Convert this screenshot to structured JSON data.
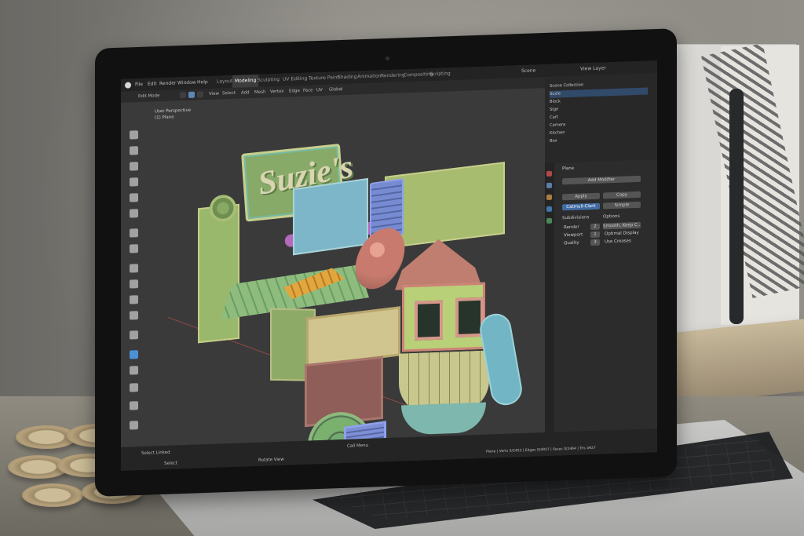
{
  "blender": {
    "menu": [
      "File",
      "Edit",
      "Render",
      "Window",
      "Help"
    ],
    "workspaces": [
      "Layout",
      "Modeling",
      "Sculpting",
      "UV Editing",
      "Texture Paint",
      "Shading",
      "Animation",
      "Rendering",
      "Compositing",
      "Scripting"
    ],
    "active_workspace": "Modeling",
    "scene_name": "Scene",
    "view_layer": "View Layer",
    "mode": "Edit Mode",
    "header_items": [
      "View",
      "Select",
      "Add",
      "Mesh",
      "Vertex",
      "Edge",
      "Face",
      "UV"
    ],
    "transform_space": "Global",
    "viewport": {
      "perspective": "User Perspective",
      "object": "(1) Plane"
    },
    "outliner": {
      "collection": "Scene Collection",
      "items": [
        "Suzie",
        "Block",
        "Sign",
        "Cart",
        "Camera",
        "Kitchen",
        "Box"
      ]
    },
    "properties": {
      "object_name": "Plane",
      "modifier_add": "Add Modifier",
      "apply": "Apply",
      "copy": "Copy",
      "catmull_clark": "Catmull-Clark",
      "simple": "Simple",
      "subdivisions": "Subdivisions",
      "options": "Options",
      "render_label": "Render",
      "render_value": "2",
      "viewport_label": "Viewport",
      "viewport_value": "1",
      "quality_label": "Quality",
      "quality_value": "3",
      "smooth_label": "Smooth, Keep C...",
      "optimal_display": "Optimal Display",
      "use_creases": "Use Creases"
    },
    "status": {
      "left": "Select",
      "middle": "Rotate View",
      "right": "Call Menu",
      "bottom_left": "Select Linked",
      "stats": "Plane | Verts 0/2453 | Edges 0/4927 | Faces 0/2464 | Tris 4927"
    },
    "model_text": "Suzie's"
  },
  "colors": {
    "blender_bg": "#303030",
    "active_blue": "#4b91d4",
    "selection_blue": "#324a69"
  }
}
